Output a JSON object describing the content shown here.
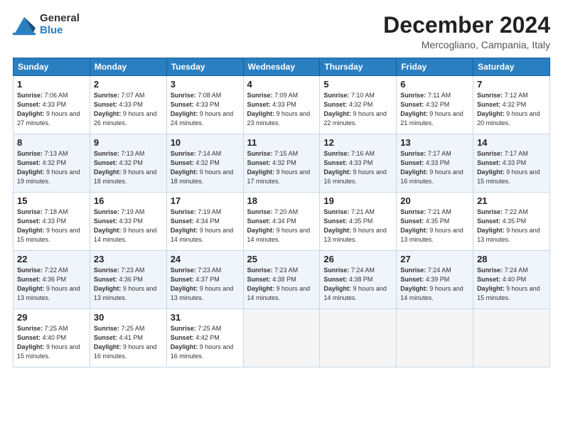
{
  "logo": {
    "general": "General",
    "blue": "Blue"
  },
  "title": "December 2024",
  "location": "Mercogliano, Campania, Italy",
  "days_of_week": [
    "Sunday",
    "Monday",
    "Tuesday",
    "Wednesday",
    "Thursday",
    "Friday",
    "Saturday"
  ],
  "weeks": [
    [
      {
        "day": "1",
        "sunrise": "7:06 AM",
        "sunset": "4:33 PM",
        "daylight": "9 hours and 27 minutes."
      },
      {
        "day": "2",
        "sunrise": "7:07 AM",
        "sunset": "4:33 PM",
        "daylight": "9 hours and 26 minutes."
      },
      {
        "day": "3",
        "sunrise": "7:08 AM",
        "sunset": "4:33 PM",
        "daylight": "9 hours and 24 minutes."
      },
      {
        "day": "4",
        "sunrise": "7:09 AM",
        "sunset": "4:33 PM",
        "daylight": "9 hours and 23 minutes."
      },
      {
        "day": "5",
        "sunrise": "7:10 AM",
        "sunset": "4:32 PM",
        "daylight": "9 hours and 22 minutes."
      },
      {
        "day": "6",
        "sunrise": "7:11 AM",
        "sunset": "4:32 PM",
        "daylight": "9 hours and 21 minutes."
      },
      {
        "day": "7",
        "sunrise": "7:12 AM",
        "sunset": "4:32 PM",
        "daylight": "9 hours and 20 minutes."
      }
    ],
    [
      {
        "day": "8",
        "sunrise": "7:13 AM",
        "sunset": "4:32 PM",
        "daylight": "9 hours and 19 minutes."
      },
      {
        "day": "9",
        "sunrise": "7:13 AM",
        "sunset": "4:32 PM",
        "daylight": "9 hours and 18 minutes."
      },
      {
        "day": "10",
        "sunrise": "7:14 AM",
        "sunset": "4:32 PM",
        "daylight": "9 hours and 18 minutes."
      },
      {
        "day": "11",
        "sunrise": "7:15 AM",
        "sunset": "4:32 PM",
        "daylight": "9 hours and 17 minutes."
      },
      {
        "day": "12",
        "sunrise": "7:16 AM",
        "sunset": "4:33 PM",
        "daylight": "9 hours and 16 minutes."
      },
      {
        "day": "13",
        "sunrise": "7:17 AM",
        "sunset": "4:33 PM",
        "daylight": "9 hours and 16 minutes."
      },
      {
        "day": "14",
        "sunrise": "7:17 AM",
        "sunset": "4:33 PM",
        "daylight": "9 hours and 15 minutes."
      }
    ],
    [
      {
        "day": "15",
        "sunrise": "7:18 AM",
        "sunset": "4:33 PM",
        "daylight": "9 hours and 15 minutes."
      },
      {
        "day": "16",
        "sunrise": "7:19 AM",
        "sunset": "4:33 PM",
        "daylight": "9 hours and 14 minutes."
      },
      {
        "day": "17",
        "sunrise": "7:19 AM",
        "sunset": "4:34 PM",
        "daylight": "9 hours and 14 minutes."
      },
      {
        "day": "18",
        "sunrise": "7:20 AM",
        "sunset": "4:34 PM",
        "daylight": "9 hours and 14 minutes."
      },
      {
        "day": "19",
        "sunrise": "7:21 AM",
        "sunset": "4:35 PM",
        "daylight": "9 hours and 13 minutes."
      },
      {
        "day": "20",
        "sunrise": "7:21 AM",
        "sunset": "4:35 PM",
        "daylight": "9 hours and 13 minutes."
      },
      {
        "day": "21",
        "sunrise": "7:22 AM",
        "sunset": "4:35 PM",
        "daylight": "9 hours and 13 minutes."
      }
    ],
    [
      {
        "day": "22",
        "sunrise": "7:22 AM",
        "sunset": "4:36 PM",
        "daylight": "9 hours and 13 minutes."
      },
      {
        "day": "23",
        "sunrise": "7:23 AM",
        "sunset": "4:36 PM",
        "daylight": "9 hours and 13 minutes."
      },
      {
        "day": "24",
        "sunrise": "7:23 AM",
        "sunset": "4:37 PM",
        "daylight": "9 hours and 13 minutes."
      },
      {
        "day": "25",
        "sunrise": "7:23 AM",
        "sunset": "4:38 PM",
        "daylight": "9 hours and 14 minutes."
      },
      {
        "day": "26",
        "sunrise": "7:24 AM",
        "sunset": "4:38 PM",
        "daylight": "9 hours and 14 minutes."
      },
      {
        "day": "27",
        "sunrise": "7:24 AM",
        "sunset": "4:39 PM",
        "daylight": "9 hours and 14 minutes."
      },
      {
        "day": "28",
        "sunrise": "7:24 AM",
        "sunset": "4:40 PM",
        "daylight": "9 hours and 15 minutes."
      }
    ],
    [
      {
        "day": "29",
        "sunrise": "7:25 AM",
        "sunset": "4:40 PM",
        "daylight": "9 hours and 15 minutes."
      },
      {
        "day": "30",
        "sunrise": "7:25 AM",
        "sunset": "4:41 PM",
        "daylight": "9 hours and 16 minutes."
      },
      {
        "day": "31",
        "sunrise": "7:25 AM",
        "sunset": "4:42 PM",
        "daylight": "9 hours and 16 minutes."
      },
      null,
      null,
      null,
      null
    ]
  ],
  "labels": {
    "sunrise": "Sunrise: ",
    "sunset": "Sunset: ",
    "daylight": "Daylight: "
  }
}
